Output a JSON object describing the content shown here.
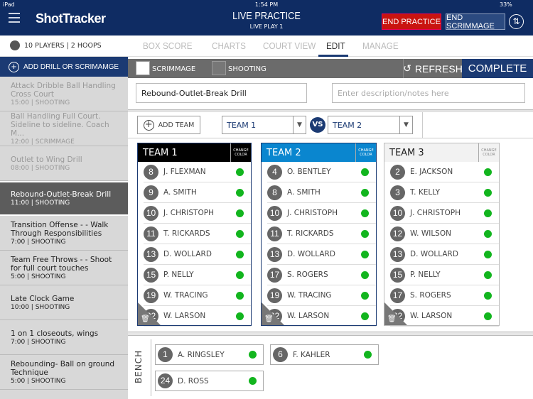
{
  "status": {
    "device": "iPad",
    "time": "1:54 PM",
    "battery": "33%"
  },
  "header": {
    "logo": "ShotTracker",
    "title": "LIVE PRACTICE",
    "subtitle": "LIVE PLAY 1",
    "end_practice": "END PRACTICE",
    "end_scrimmage": "END SCRIMMAGE"
  },
  "subheader": {
    "players": "10 PLAYERS  |  2 HOOPS",
    "tabs": [
      "BOX SCORE",
      "CHARTS",
      "COURT VIEW",
      "EDIT",
      "MANAGE"
    ],
    "active_tab": "EDIT"
  },
  "sidebar": {
    "add_label": "ADD DRILL OR SCRIMAMGE",
    "drills": [
      {
        "name": "Attack Dribble Ball Handling Cross Court",
        "meta": "15:00  |  SHOOTING",
        "state": "done"
      },
      {
        "name": "Ball Handling Full Court. Sideline to sideline. Coach M...",
        "meta": "12:00  |  SCRIMMAGE",
        "state": "done"
      },
      {
        "name": "Outlet to Wing Drill",
        "meta": "08:00  |  SHOOTING",
        "state": "done"
      },
      {
        "name": "Rebound-Outlet-Break Drill",
        "meta": "11:00  |  SHOOTING",
        "state": "selected"
      },
      {
        "name": "Transition Offense - - Walk Through Responsibilities",
        "meta": "7:00  |  SHOOTING",
        "state": "upcoming"
      },
      {
        "name": "Team Free Throws - - Shoot for full court touches",
        "meta": "5:00  |  SHOOTING",
        "state": "upcoming"
      },
      {
        "name": "Late Clock Game",
        "meta": "10:00  |  SHOOTING",
        "state": "upcoming"
      },
      {
        "name": "1 on 1 closeouts, wings",
        "meta": "7:00  |  SHOOTING",
        "state": "upcoming"
      },
      {
        "name": "Rebounding- Ball on ground Technique",
        "meta": "5:00  |  SHOOTING",
        "state": "upcoming"
      }
    ]
  },
  "toolbar": {
    "scrimmage": "SCRIMMAGE",
    "shooting": "SHOOTING",
    "refresh": "REFRESH",
    "complete": "COMPLETE"
  },
  "drill": {
    "name": "Rebound-Outlet-Break Drill",
    "description_placeholder": "Enter description/notes here"
  },
  "teambar": {
    "add_team": "ADD TEAM",
    "team_a": "TEAM 1",
    "vs": "VS",
    "team_b": "TEAM 2"
  },
  "change_color": "CHANGE COLOR",
  "teams": [
    {
      "name": "TEAM 1",
      "color": "#000000",
      "players": [
        [
          "8",
          "J. FLEXMAN"
        ],
        [
          "9",
          "A. SMITH"
        ],
        [
          "10",
          "J. CHRISTOPH"
        ],
        [
          "11",
          "T. RICKARDS"
        ],
        [
          "13",
          "D. WOLLARD"
        ],
        [
          "15",
          "P. NELLY"
        ],
        [
          "19",
          "W. TRACING"
        ],
        [
          "22",
          "W. LARSON"
        ]
      ]
    },
    {
      "name": "TEAM 2",
      "color": "#0a86cf",
      "players": [
        [
          "4",
          "O. BENTLEY"
        ],
        [
          "8",
          "A. SMITH"
        ],
        [
          "10",
          "J. CHRISTOPH"
        ],
        [
          "11",
          "T. RICKARDS"
        ],
        [
          "13",
          "D. WOLLARD"
        ],
        [
          "17",
          "S. ROGERS"
        ],
        [
          "19",
          "W. TRACING"
        ],
        [
          "22",
          "W. LARSON"
        ]
      ]
    },
    {
      "name": "TEAM 3",
      "color": "#f2f2f2",
      "players": [
        [
          "2",
          "E. JACKSON"
        ],
        [
          "3",
          "T. KELLY"
        ],
        [
          "10",
          "J. CHRISTOPH"
        ],
        [
          "12",
          "W. WILSON"
        ],
        [
          "13",
          "D. WOLLARD"
        ],
        [
          "15",
          "P. NELLY"
        ],
        [
          "17",
          "S. ROGERS"
        ],
        [
          "22",
          "W. LARSON"
        ]
      ]
    }
  ],
  "bench": {
    "label": "BENCH",
    "players": [
      [
        "1",
        "A. RINGSLEY"
      ],
      [
        "6",
        "F. KAHLER"
      ],
      [
        "24",
        "D. ROSS"
      ]
    ]
  },
  "colors": {
    "navy": "#1b3a73",
    "end_practice": "#c9140f",
    "active_dot": "#12b51e"
  }
}
